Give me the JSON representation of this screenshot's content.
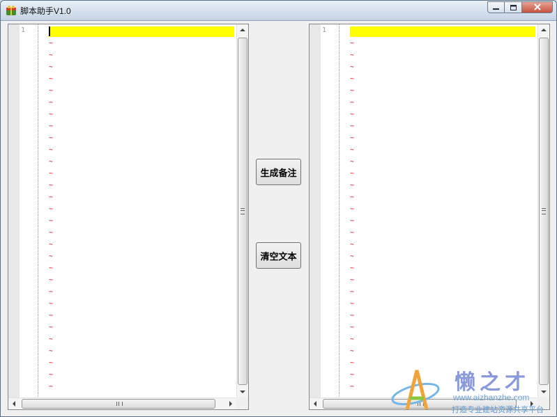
{
  "window": {
    "title": "脚本助手V1.0"
  },
  "left_editor": {
    "line_number": "1",
    "tilde_glyph": "~",
    "tilde_count": 31
  },
  "right_editor": {
    "line_number": "1",
    "tilde_glyph": "~",
    "tilde_count": 31
  },
  "buttons": {
    "generate_label": "生成备注",
    "clear_label": "清空文本"
  },
  "watermark": {
    "logo_text": "懒之才",
    "url": "www.aizhanzhe.com",
    "slogan": "打造专业建站资源共享平台"
  },
  "colors": {
    "highlight": "#ffff00",
    "tilde": "#e00000"
  }
}
